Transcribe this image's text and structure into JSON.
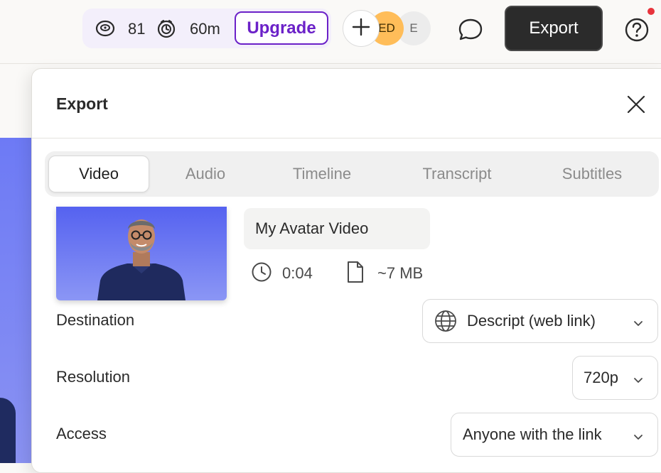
{
  "topbar": {
    "credits_icon": "coins-icon",
    "credits_value": "81",
    "time_icon": "timer-icon",
    "time_value": "60m",
    "upgrade_label": "Upgrade",
    "add_icon": "plus-icon",
    "collaborators": [
      "ED",
      "E"
    ],
    "comment_icon": "comment-icon",
    "export_label": "Export",
    "help_icon": "help-icon",
    "accent_color": "#6b21c8",
    "notification_color": "#e8343c"
  },
  "modal": {
    "title": "Export",
    "close_icon": "close-icon",
    "tabs": [
      {
        "label": "Video",
        "active": true
      },
      {
        "label": "Audio",
        "active": false
      },
      {
        "label": "Timeline",
        "active": false
      },
      {
        "label": "Transcript",
        "active": false
      },
      {
        "label": "Subtitles",
        "active": false
      }
    ],
    "video": {
      "title": "My Avatar Video",
      "duration_icon": "clock-icon",
      "duration": "0:04",
      "size_icon": "file-icon",
      "size": "~7 MB"
    },
    "settings": {
      "destination": {
        "label": "Destination",
        "value": "Descript (web link)",
        "icon": "globe-icon"
      },
      "resolution": {
        "label": "Resolution",
        "value": "720p"
      },
      "access": {
        "label": "Access",
        "value": "Anyone with the link"
      }
    }
  }
}
